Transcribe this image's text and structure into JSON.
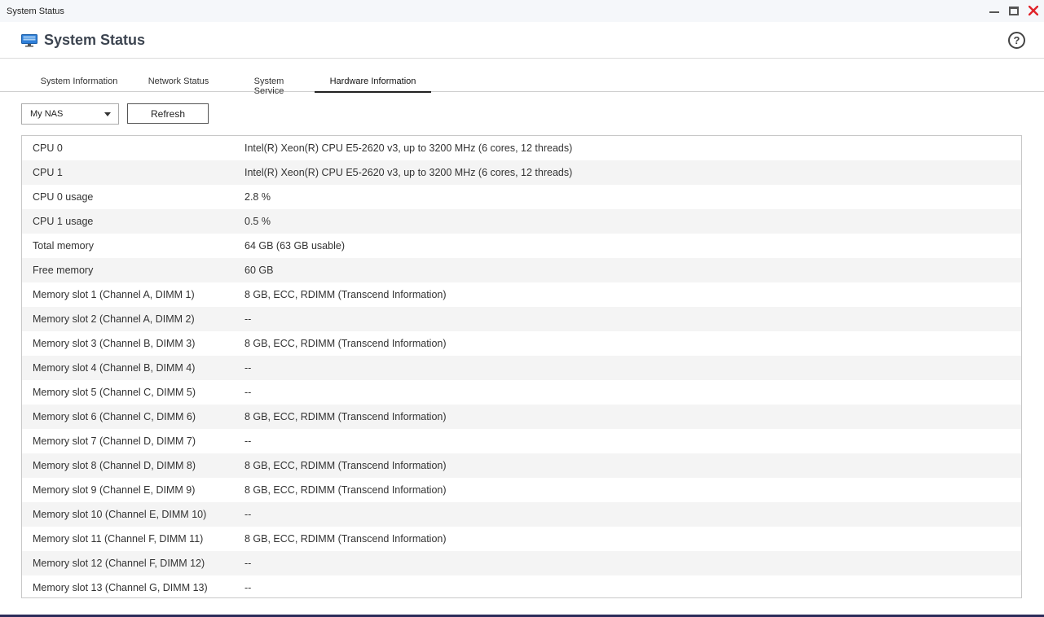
{
  "window": {
    "title": "System Status",
    "app_title": "System Status"
  },
  "tabs": [
    {
      "label": "System Information"
    },
    {
      "label": "Network Status"
    },
    {
      "label": "System Service"
    },
    {
      "label": "Hardware Information",
      "active": true
    }
  ],
  "toolbar": {
    "device_select_value": "My NAS",
    "refresh_label": "Refresh"
  },
  "hardware_rows": [
    {
      "label": "CPU 0",
      "value": "Intel(R) Xeon(R) CPU E5-2620 v3, up to 3200 MHz (6 cores, 12 threads)"
    },
    {
      "label": "CPU 1",
      "value": "Intel(R) Xeon(R) CPU E5-2620 v3, up to 3200 MHz (6 cores, 12 threads)"
    },
    {
      "label": "CPU 0 usage",
      "value": "2.8 %"
    },
    {
      "label": "CPU 1 usage",
      "value": "0.5 %"
    },
    {
      "label": "Total memory",
      "value": "64 GB (63 GB usable)"
    },
    {
      "label": "Free memory",
      "value": "60 GB"
    },
    {
      "label": "Memory slot 1 (Channel A, DIMM 1)",
      "value": "8 GB, ECC, RDIMM (Transcend Information)"
    },
    {
      "label": "Memory slot 2 (Channel A, DIMM 2)",
      "value": "--"
    },
    {
      "label": "Memory slot 3 (Channel B, DIMM 3)",
      "value": "8 GB, ECC, RDIMM (Transcend Information)"
    },
    {
      "label": "Memory slot 4 (Channel B, DIMM 4)",
      "value": "--"
    },
    {
      "label": "Memory slot 5 (Channel C, DIMM 5)",
      "value": "--"
    },
    {
      "label": "Memory slot 6 (Channel C, DIMM 6)",
      "value": "8 GB, ECC, RDIMM (Transcend Information)"
    },
    {
      "label": "Memory slot 7 (Channel D, DIMM 7)",
      "value": "--"
    },
    {
      "label": "Memory slot 8 (Channel D, DIMM 8)",
      "value": "8 GB, ECC, RDIMM (Transcend Information)"
    },
    {
      "label": "Memory slot 9 (Channel E, DIMM 9)",
      "value": "8 GB, ECC, RDIMM (Transcend Information)"
    },
    {
      "label": "Memory slot 10 (Channel E, DIMM 10)",
      "value": "--"
    },
    {
      "label": "Memory slot 11 (Channel F, DIMM 11)",
      "value": "8 GB, ECC, RDIMM (Transcend Information)"
    },
    {
      "label": "Memory slot 12 (Channel F, DIMM 12)",
      "value": "--"
    },
    {
      "label": "Memory slot 13 (Channel G, DIMM 13)",
      "value": "--"
    }
  ],
  "icons": {
    "app": "monitor-icon",
    "help": "help-icon",
    "minimize": "minimize-icon",
    "maximize": "maximize-icon",
    "close": "close-icon",
    "dropdown": "chevron-down-icon"
  },
  "colors": {
    "close": "#e0242a",
    "app_icon": "#2f7fd8",
    "accent_strip": "#6c9ee0",
    "row_alt": "#f4f4f4"
  }
}
